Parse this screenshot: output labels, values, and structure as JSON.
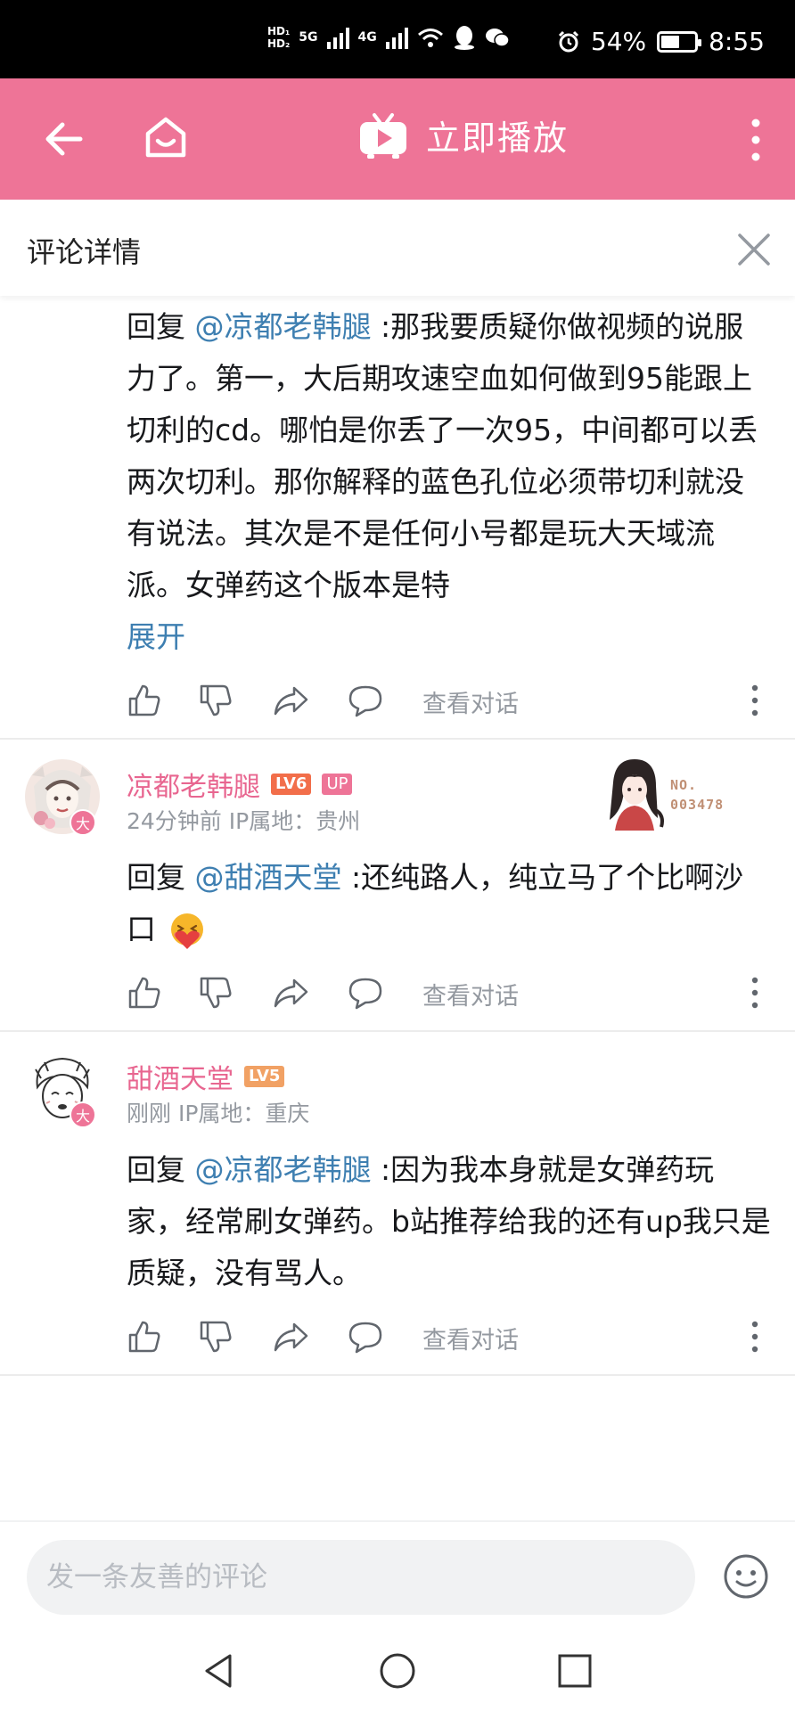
{
  "status_bar": {
    "hd1": "HD₁",
    "hd2": "HD₂",
    "net1": "5G",
    "net2": "4G",
    "battery": "54%",
    "time": "8:55"
  },
  "header": {
    "title": "立即播放",
    "back_icon": "arrow-left-icon",
    "home_icon": "home-icon",
    "more_icon": "more-vertical-icon"
  },
  "detail": {
    "title": "评论详情",
    "close_icon": "close-icon"
  },
  "comments": [
    {
      "reply_prefix": "回复 ",
      "mention": "@凉都老韩腿",
      "text": " :那我要质疑你做视频的说服力了。第一，大后期攻速空血如何做到95能跟上切利的cd。哪怕是你丢了一次95，中间都可以丢两次切利。那你解释的蓝色孔位必须带切利就没有说法。其次是不是任何小号都是玩大天域流派。女弹药这个版本是特",
      "expand": "展开",
      "view_dialog": "查看对话"
    },
    {
      "username": "凉都老韩腿",
      "level": "LV6",
      "up_badge": "UP",
      "avatar_badge": "大",
      "meta": "24分钟前 IP属地：贵州",
      "fan_card_no": "NO.",
      "fan_card_num": "003478",
      "reply_prefix": "回复 ",
      "mention": "@甜酒天堂",
      "text": " :还纯路人，纯立马了个比啊沙口",
      "view_dialog": "查看对话"
    },
    {
      "username": "甜酒天堂",
      "level": "LV5",
      "avatar_badge": "大",
      "meta": "刚刚 IP属地：重庆",
      "reply_prefix": "回复 ",
      "mention": "@凉都老韩腿",
      "text": " :因为我本身就是女弹药玩家，经常刷女弹药。b站推荐给我的还有up我只是质疑，没有骂人。",
      "view_dialog": "查看对话"
    }
  ],
  "input": {
    "placeholder": "发一条友善的评论"
  },
  "colors": {
    "brand_pink": "#ee7497",
    "link_blue": "#3e7fb1",
    "username_pink": "#e86690",
    "muted_gray": "#9499a0"
  }
}
